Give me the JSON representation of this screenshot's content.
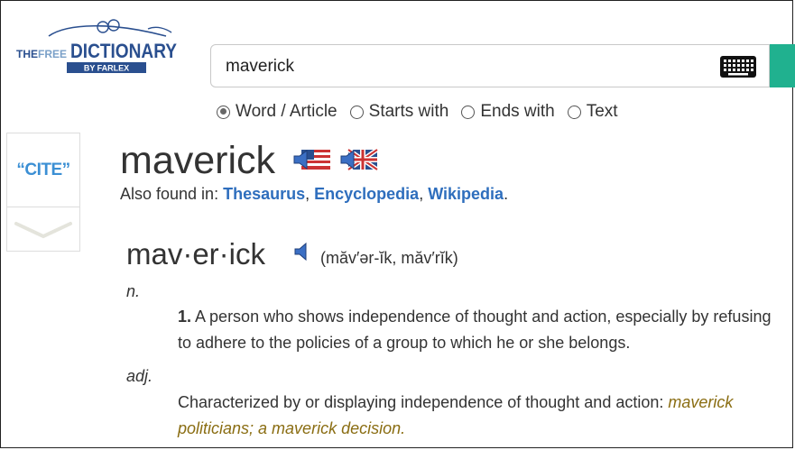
{
  "logo": {
    "line1": "THE",
    "line2": "FREE",
    "line3": "DICTIONARY",
    "line4": "BY FARLEX"
  },
  "search": {
    "value": "maverick",
    "keyboard_icon": "keyboard-icon",
    "accent_color": "#20b18f"
  },
  "search_modes": [
    {
      "label": "Word / Article",
      "checked": true
    },
    {
      "label": "Starts with",
      "checked": false
    },
    {
      "label": "Ends with",
      "checked": false
    },
    {
      "label": "Text",
      "checked": false
    }
  ],
  "side": {
    "cite_label": "“CITE”",
    "chevron_icon": "chevron-down-icon"
  },
  "entry": {
    "headword": "maverick",
    "also_found_label": "Also found in:",
    "also_found_links": [
      "Thesaurus",
      "Encyclopedia",
      "Wikipedia"
    ],
    "link_color": "#2e6ebd",
    "syllabified": "mav·er·ick",
    "pronunciation": "(măv′ər-ĭk, măv′rĭk)",
    "senses": [
      {
        "pos": "n.",
        "number": "1.",
        "text": "A person who shows independence of thought and action, especially by refusing to adhere to the policies of a group to which he or she belongs."
      },
      {
        "pos": "adj.",
        "text": "Characterized by or displaying independence of thought and action:",
        "example": "maverick politicians; a maverick decision."
      }
    ],
    "example_color": "#8a6d12"
  }
}
